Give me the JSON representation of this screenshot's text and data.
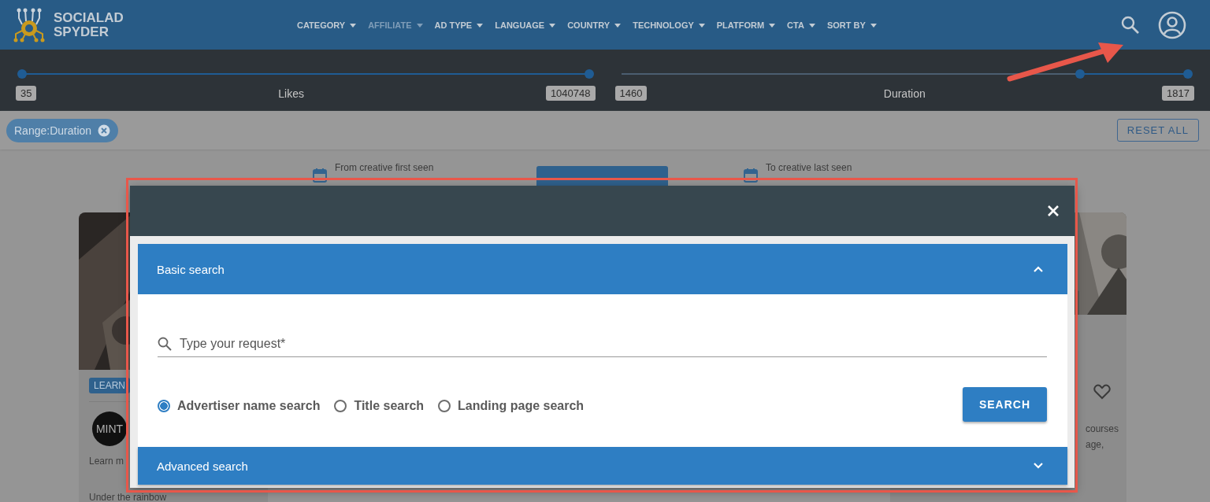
{
  "header": {
    "logo": [
      "SOCIALAD",
      "SPYDER"
    ],
    "nav": [
      {
        "label": "CATEGORY",
        "disabled": false
      },
      {
        "label": "AFFILIATE",
        "disabled": true
      },
      {
        "label": "AD TYPE",
        "disabled": false
      },
      {
        "label": "LANGUAGE",
        "disabled": false
      },
      {
        "label": "COUNTRY",
        "disabled": false
      },
      {
        "label": "TECHNOLOGY",
        "disabled": false
      },
      {
        "label": "PLATFORM",
        "disabled": false
      },
      {
        "label": "CTA",
        "disabled": false
      },
      {
        "label": "SORT BY",
        "disabled": false
      }
    ]
  },
  "sliders": [
    {
      "label": "Likes",
      "min": "35",
      "max": "1040748",
      "thumbs": [
        {
          "level": 0
        },
        {
          "level": 1
        }
      ]
    },
    {
      "label": "Duration",
      "min": "1460",
      "max": "1817",
      "thumbs": [
        {
          "level": 0.81
        },
        {
          "level": 1
        }
      ]
    }
  ],
  "filter_chips": [
    {
      "label": "Range:Duration"
    }
  ],
  "reset_button": "RESET ALL",
  "date_range": {
    "from_label": "From creative first seen",
    "to_label": "To creative last seen"
  },
  "cards": [
    {
      "badge": "LEARN",
      "avatar": "MINT",
      "text_lines": [
        "Learn m",
        "Under the rainbow"
      ]
    },
    {
      "text_lines": [
        "courses",
        "age,"
      ]
    }
  ],
  "modal": {
    "sections": [
      {
        "title": "Basic search",
        "expanded": true,
        "search_field": {
          "placeholder": "Type your request*"
        },
        "search_modes": [
          {
            "label": "Advertiser name search",
            "selected": true
          },
          {
            "label": "Title search",
            "selected": false
          },
          {
            "label": "Landing page search",
            "selected": false
          }
        ],
        "search_button": "SEARCH"
      },
      {
        "title": "Advanced search",
        "expanded": false
      }
    ]
  }
}
